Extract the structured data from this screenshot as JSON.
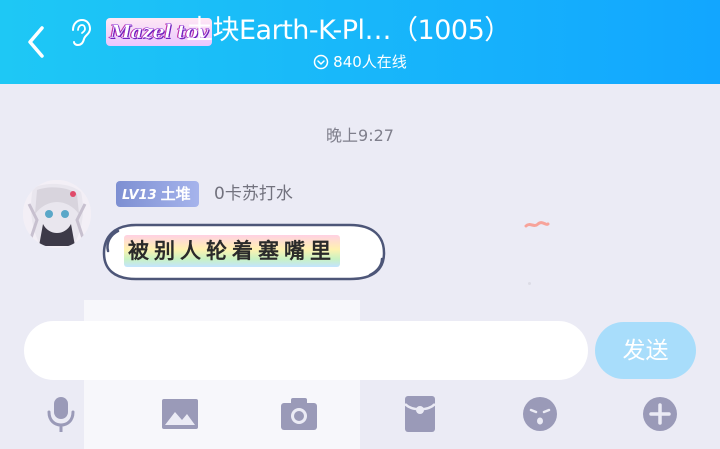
{
  "header": {
    "back_icon": "chevron-left-icon",
    "ear_icon": "ear-icon",
    "logo_text": "Mazel tov",
    "title": "土块Earth-K-Pl…（1005）",
    "online_icon": "chevron-down-circle-icon",
    "online_text": "840人在线"
  },
  "chat": {
    "timestamp": "晚上9:27",
    "message": {
      "badge_level": "LV13",
      "badge_title": "土堆",
      "sender": "0卡苏打水",
      "text": "被别人轮着塞嘴里"
    }
  },
  "input_bar": {
    "value": "",
    "placeholder": "",
    "send_label": "发送"
  },
  "toolbar": {
    "items": [
      "microphone-icon",
      "image-icon",
      "camera-icon",
      "red-packet-icon",
      "emoji-icon",
      "plus-icon"
    ]
  },
  "colors": {
    "header_start": "#1ec8f5",
    "header_end": "#12a6ff",
    "send_button": "#a8ddfb",
    "toolbar_icon": "#9a9ab8",
    "background": "#ebebf5"
  }
}
